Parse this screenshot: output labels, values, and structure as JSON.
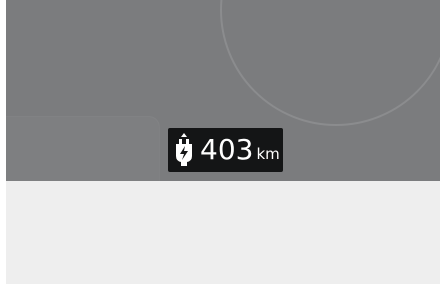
{
  "cluster": {
    "range_value": "403",
    "range_unit": "km",
    "range_icon": "ev-charge-plug-icon"
  },
  "colors": {
    "display_background": "#7b7c7e",
    "badge_background": "#141516",
    "badge_text": "#ffffff",
    "lower_background": "#eeeeee"
  }
}
